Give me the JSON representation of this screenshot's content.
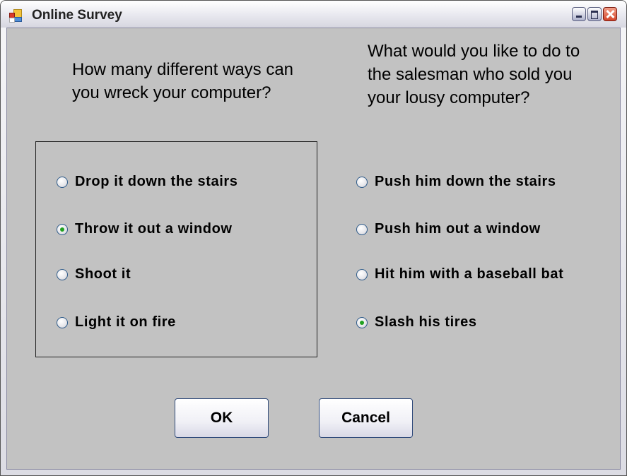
{
  "window": {
    "title": "Online Survey",
    "controls": {
      "minimize": "minimize",
      "maximize": "maximize",
      "close": "close"
    }
  },
  "left_group": {
    "question": "How many different ways can you wreck your computer?",
    "options": [
      {
        "label": "Drop it down the stairs",
        "selected": false
      },
      {
        "label": "Throw it out a window",
        "selected": true
      },
      {
        "label": "Shoot it",
        "selected": false
      },
      {
        "label": "Light it on fire",
        "selected": false
      }
    ]
  },
  "right_group": {
    "question": "What would you like to do to the salesman who sold you your lousy computer?",
    "options": [
      {
        "label": "Push him down the stairs",
        "selected": false
      },
      {
        "label": "Push him out a window",
        "selected": false
      },
      {
        "label": "Hit him with a baseball bat",
        "selected": false
      },
      {
        "label": "Slash his tires",
        "selected": true
      }
    ]
  },
  "buttons": {
    "ok": "OK",
    "cancel": "Cancel"
  }
}
